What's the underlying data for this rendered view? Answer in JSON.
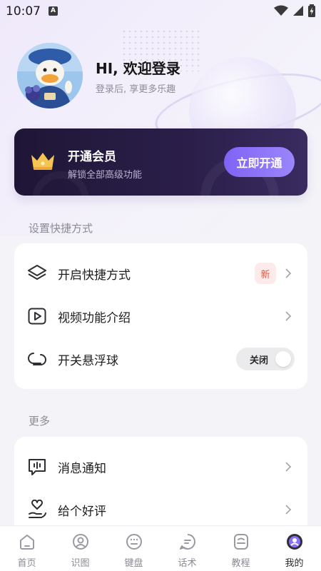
{
  "status_bar": {
    "time": "10:07",
    "indicator": "A"
  },
  "profile": {
    "greeting": "HI, 欢迎登录",
    "subtitle": "登录后, 享更多乐趣"
  },
  "vip": {
    "title": "开通会员",
    "subtitle": "解锁全部高级功能",
    "button": "立即开通"
  },
  "sections": {
    "shortcuts_title": "设置快捷方式",
    "more_title": "更多"
  },
  "shortcut_items": [
    {
      "label": "开启快捷方式",
      "badge": "新",
      "icon": "layers-icon"
    },
    {
      "label": "视频功能介绍",
      "icon": "play-video-icon"
    },
    {
      "label": "开关悬浮球",
      "toggle_label": "关闭",
      "toggle_on": false,
      "icon": "float-ball-icon"
    }
  ],
  "more_items": [
    {
      "label": "消息通知",
      "icon": "message-notification-icon"
    },
    {
      "label": "给个好评",
      "icon": "heart-hand-icon"
    }
  ],
  "bottom_nav": [
    {
      "label": "首页",
      "icon": "home-icon"
    },
    {
      "label": "识图",
      "icon": "image-recognition-icon"
    },
    {
      "label": "键盘",
      "icon": "keyboard-icon"
    },
    {
      "label": "话术",
      "icon": "chat-script-icon"
    },
    {
      "label": "教程",
      "icon": "tutorial-icon"
    },
    {
      "label": "我的",
      "icon": "profile-icon",
      "active": true
    }
  ],
  "colors": {
    "accent": "#8a70f7",
    "vip_card": "#241a3f",
    "badge_new_text": "#e8543b",
    "badge_new_bg": "#fdeaea"
  }
}
